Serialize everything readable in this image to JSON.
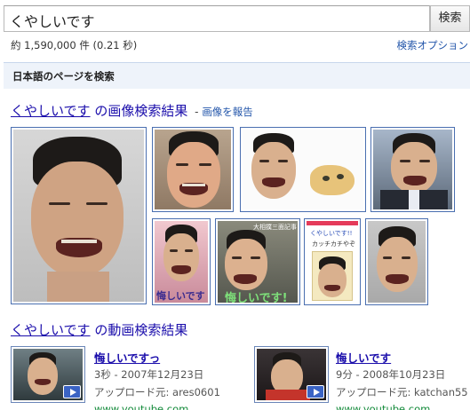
{
  "search": {
    "query": "くやしいです",
    "button_label": "検索"
  },
  "stats": {
    "text": "約 1,590,000 件 (0.21 秒)"
  },
  "search_options_label": "検索オプション",
  "jp_filter_label": "日本語のページを検索",
  "image_results": {
    "query_link": "くやしいです",
    "title_rest": " の画像検索結果",
    "separator": " - ",
    "report_label": "画像を報告",
    "captions": {
      "thumb_6": "悔しいです",
      "thumb_7_top": "大相撲三面記事",
      "thumb_7_bottom": "悔しいです!",
      "thumb_8": "くやしいです!!",
      "thumb_8_sub": "カッチカチやぞ"
    }
  },
  "video_results": {
    "query_link": "くやしいです",
    "title_rest": " の動画検索結果",
    "items": [
      {
        "title": "悔しいですっ",
        "duration_date": "3秒 - 2007年12月23日",
        "uploader": "アップロード元: ares0601",
        "url": "www.youtube.com"
      },
      {
        "title": "悔しいです",
        "duration_date": "9分 - 2008年10月23日",
        "uploader": "アップロード元: katchan55",
        "url": "www.youtube.com"
      }
    ]
  },
  "colors": {
    "link": "#1a0dab",
    "border": "#4a6fb0",
    "play": "#3a63c4",
    "bar": "#eef3fa"
  }
}
